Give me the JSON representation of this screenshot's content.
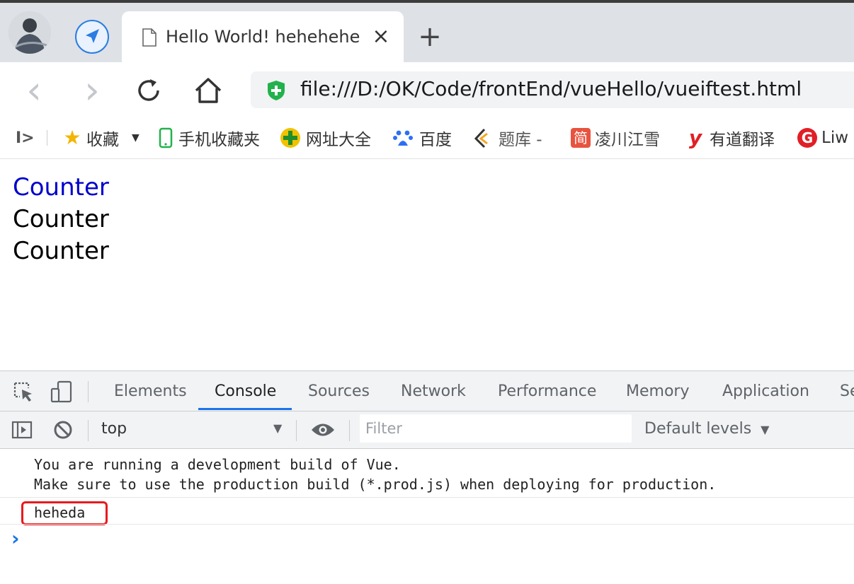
{
  "tab": {
    "title": "Hello World! hehehehehe",
    "close_glyph": "×",
    "new_tab_glyph": "+"
  },
  "toolbar": {
    "back_glyph": "‹",
    "forward_glyph": "›",
    "url": "file:///D:/OK/Code/frontEnd/vueHello/vueiftest.html"
  },
  "bookmarks": {
    "sidebar_glyph": "I>",
    "items": [
      {
        "label": "收藏",
        "icon": "star-icon"
      },
      {
        "label": "手机收藏夹",
        "icon": "phone-icon"
      },
      {
        "label": "网址大全",
        "icon": "site-nav-icon"
      },
      {
        "label": "百度",
        "icon": "baidu-paw-icon"
      },
      {
        "label": "题库 -",
        "icon": "tiku-icon"
      },
      {
        "label": "凌川江雪",
        "icon": "jian-icon",
        "icon_text": "简"
      },
      {
        "label": "有道翻译",
        "icon": "youdao-icon",
        "icon_text": "y"
      },
      {
        "label": "Liw",
        "icon": "g-logo-icon",
        "icon_text": "G"
      }
    ]
  },
  "page": {
    "counters": [
      {
        "text": "Counter",
        "color": "#0000cc"
      },
      {
        "text": "Counter",
        "color": "#000000"
      },
      {
        "text": "Counter",
        "color": "#000000"
      }
    ]
  },
  "devtools": {
    "tabs": [
      "Elements",
      "Console",
      "Sources",
      "Network",
      "Performance",
      "Memory",
      "Application",
      "Se"
    ],
    "active_tab": "Console",
    "context": "top",
    "filter_placeholder": "Filter",
    "levels": "Default levels",
    "messages": {
      "line1": "You are running a development build of Vue.",
      "line2": "Make sure to use the production build (*.prod.js) when deploying for production.",
      "log": "heheda"
    },
    "prompt_glyph": "›"
  },
  "colors": {
    "accent": "#1a73e8",
    "highlight_box": "#e8191f",
    "shield_green": "#22b14c",
    "page_link": "#0000cc"
  }
}
